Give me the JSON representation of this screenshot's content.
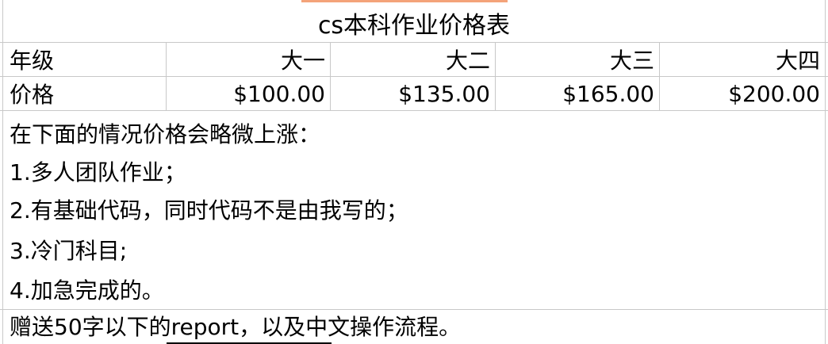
{
  "sheet": {
    "title": "cs本科作业价格表",
    "header_row": {
      "label": "年级",
      "columns": [
        "大一",
        "大二",
        "大三",
        "大四"
      ]
    },
    "price_row": {
      "label": "价格",
      "values": [
        "$100.00",
        "$135.00",
        "$165.00",
        "$200.00"
      ]
    },
    "notes": [
      "在下面的情况价格会略微上涨：",
      "1.多人团队作业；",
      "2.有基础代码，同时代码不是由我写的；",
      "3.冷门科目;",
      "4.加急完成的。",
      "赠送50字以下的report，以及中文操作流程。"
    ]
  }
}
